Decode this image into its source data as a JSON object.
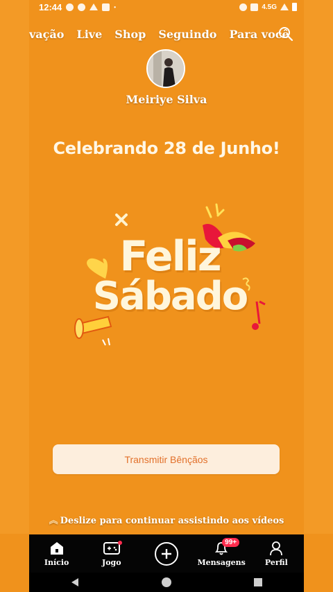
{
  "status_bar": {
    "time": "12:44",
    "network": "4.5G"
  },
  "tabs": [
    {
      "label": "vação",
      "active": false
    },
    {
      "label": "Live",
      "active": false
    },
    {
      "label": "Shop",
      "active": false
    },
    {
      "label": "Seguindo",
      "active": false
    },
    {
      "label": "Para você",
      "active": true
    }
  ],
  "profile": {
    "name": "Meiriye Silva"
  },
  "post": {
    "headline": "Celebrando 28 de Junho!",
    "art_line1": "Feliz",
    "art_line2": "Sábado",
    "cta_label": "Transmitir Bênçãos"
  },
  "swipe_hint": "Deslize para continuar assistindo aos vídeos",
  "bottom_nav": {
    "home": "Início",
    "game": "Jogo",
    "messages": "Mensagens",
    "messages_badge": "99+",
    "profile": "Perfil"
  },
  "colors": {
    "background": "#f0921c",
    "cta_text": "#e2702a",
    "badge": "#ff2d4f"
  }
}
